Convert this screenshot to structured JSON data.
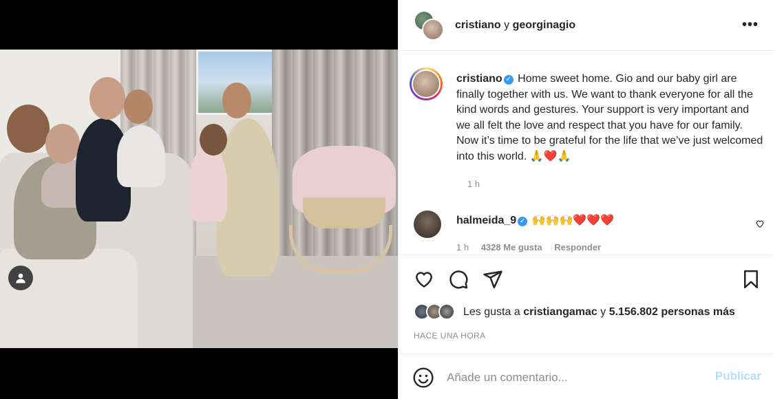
{
  "post": {
    "photo_alt": "",
    "user_tag_icon": "person-icon"
  },
  "header": {
    "user1": "cristiano",
    "connector": "y",
    "user2": "georginagio",
    "more_icon": "more-horizontal-icon"
  },
  "caption": {
    "username": "cristiano",
    "text": "Home sweet home. Gio and our baby girl are finally together with us. We want to thank everyone for all the kind words and gestures. Your support is very important and we all felt the love and respect that you have for our family. Now it’s time to be grateful for the life that we’ve just welcomed into this world. 🙏❤️🙏",
    "time": "1 h"
  },
  "comment": {
    "username": "halmeida_9",
    "text": "🙌🙌🙌❤️❤️❤️",
    "time": "1 h",
    "likes": "4328 Me gusta",
    "reply": "Responder"
  },
  "likes": {
    "prefix": "Les gusta a",
    "user": "cristiangamac",
    "middle": "y",
    "count": "5.156.802 personas más"
  },
  "timestamp": "HACE UNA HORA",
  "add_comment": {
    "placeholder": "Añade un comentario...",
    "publish": "Publicar"
  },
  "colors": {
    "verified": "#3897f0",
    "publish_disabled": "#b2dffc",
    "meta": "#8e8e8e"
  }
}
